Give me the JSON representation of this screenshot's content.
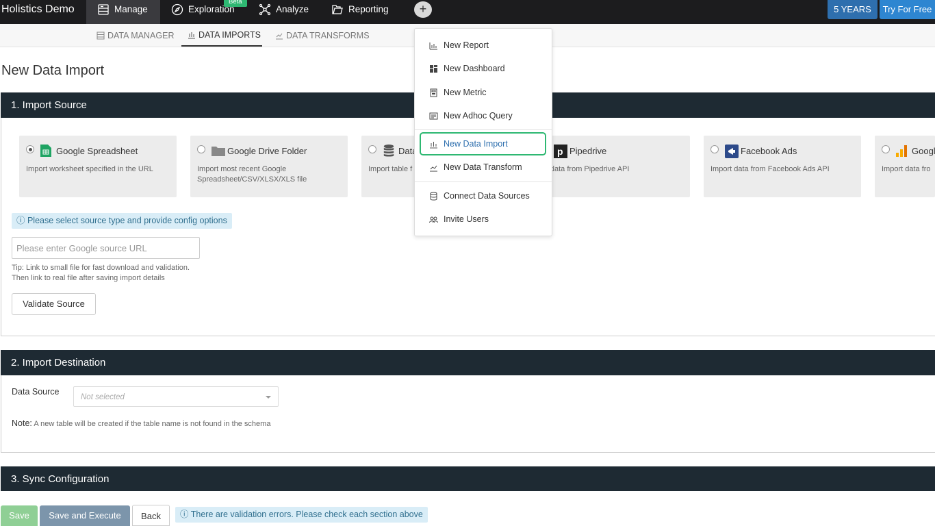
{
  "topnav": {
    "brand": "Holistics Demo",
    "items": [
      {
        "label": "Manage",
        "icon": "manage-icon"
      },
      {
        "label": "Exploration",
        "icon": "compass-icon",
        "badge": "Beta"
      },
      {
        "label": "Analyze",
        "icon": "analyze-icon"
      },
      {
        "label": "Reporting",
        "icon": "folder-icon"
      }
    ],
    "plus": "+",
    "years_label": "5 YEARS",
    "try_label": "Try For Free"
  },
  "subnav": {
    "tabs": [
      {
        "label": "Data Manager",
        "active": false
      },
      {
        "label": "Data Imports",
        "active": true
      },
      {
        "label": "Data Transforms",
        "active": false
      }
    ]
  },
  "page": {
    "title": "New Data Import"
  },
  "import_source": {
    "title": "1. Import Source",
    "sources": [
      {
        "name": "Google Spreadsheet",
        "desc": "Import worksheet specified in the URL",
        "selected": true
      },
      {
        "name": "Google Drive Folder",
        "desc": "Import most recent Google Spreadsheet/CSV/XLSX/XLS file",
        "selected": false
      },
      {
        "name": "Data",
        "desc": "Import table f database",
        "selected": false
      },
      {
        "name": "Pipedrive",
        "desc": "ort data from Pipedrive API",
        "selected": false
      },
      {
        "name": "Facebook Ads",
        "desc": "Import data from Facebook Ads API",
        "selected": false
      },
      {
        "name": "Googl",
        "desc": "Import data fro",
        "selected": false
      }
    ],
    "info": "ⓘ Please select source type and provide config options",
    "url_placeholder": "Please enter Google source URL",
    "tip_line1": "Tip: Link to small file for fast download and validation.",
    "tip_line2": "Then link to real file after saving import details",
    "validate_label": "Validate Source"
  },
  "import_destination": {
    "title": "2. Import Destination",
    "data_source_label": "Data Source",
    "select_value": "Not selected",
    "note_label": "Note:",
    "note_text": " A new table will be created if the table name is not found in the schema"
  },
  "sync_config": {
    "title": "3. Sync Configuration"
  },
  "footer": {
    "save_label": "Save",
    "save_execute_label": "Save and Execute",
    "back_label": "Back",
    "error_msg": "ⓘ There are validation errors. Please check each section above"
  },
  "dropdown": {
    "items": [
      {
        "label": "New Report",
        "icon": "bar-chart-icon"
      },
      {
        "label": "New Dashboard",
        "icon": "dashboard-icon"
      },
      {
        "label": "New Metric",
        "icon": "calculator-icon"
      },
      {
        "label": "New Adhoc Query",
        "icon": "query-icon"
      },
      {
        "label": "New Data Import",
        "icon": "data-import-icon"
      },
      {
        "label": "New Data Transform",
        "icon": "data-transform-icon"
      },
      {
        "label": "Connect Data Sources",
        "icon": "database-icon"
      },
      {
        "label": "Invite Users",
        "icon": "users-icon"
      }
    ]
  },
  "colors": {
    "accent_green": "#2eb872",
    "section_header": "#1e2a33",
    "info_bg": "#d9edf7",
    "info_text": "#31708f",
    "try_blue": "#2e86d1"
  }
}
